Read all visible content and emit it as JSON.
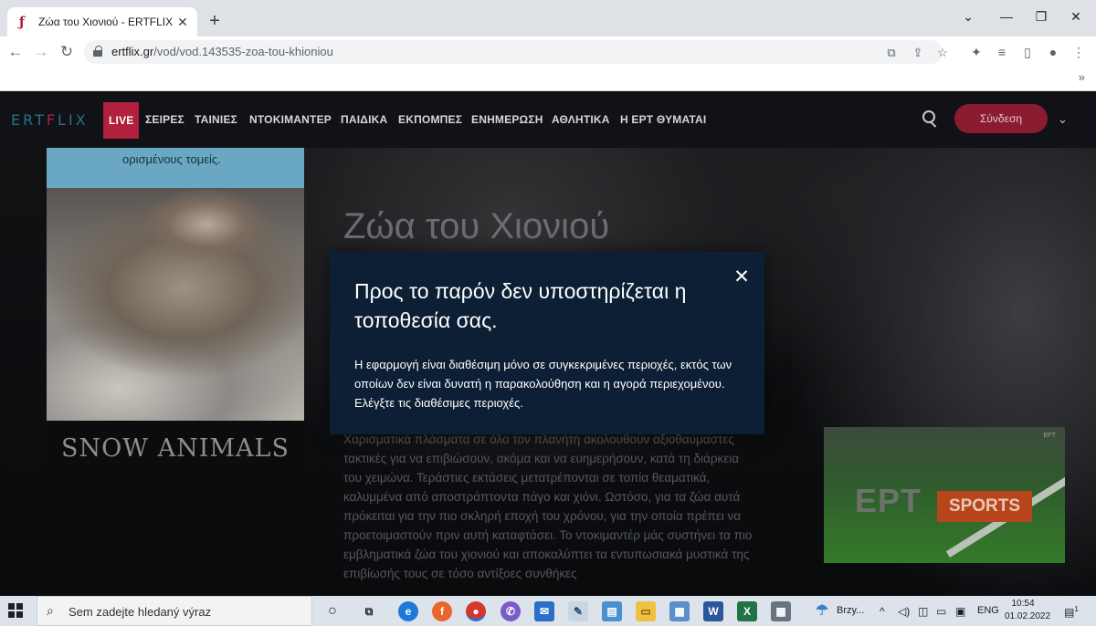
{
  "browser": {
    "tab_title": "Ζώα του Χιονιού - ERTFLIX",
    "tab_close": "✕",
    "new_tab": "+",
    "url_domain": "ertflix.gr",
    "url_path": "/vod/vod.143535-zoa-tou-khioniou",
    "bookmarks_more": "»"
  },
  "nav": {
    "logo_left": "ERT",
    "logo_mid": "F",
    "logo_right": "LIX",
    "items": [
      "LIVE",
      "ΣΕΙΡΕΣ",
      "ΤΑΙΝΙΕΣ",
      "ΝΤΟΚΙΜΑΝΤΕΡ",
      "ΠΑΙΔΙΚΑ",
      "ΕΚΠΟΜΠΕΣ",
      "ΕΝΗΜΕΡΩΣΗ",
      "ΑΘΛΗΤΙΚΑ",
      "Η ΕΡΤ ΘΥΜΑΤΑΙ"
    ],
    "login_label": "Σύνδεση",
    "menu_chevron": "⌄"
  },
  "content": {
    "poster_band_text": "ορισμένους τομείς.",
    "poster_title": "SNOW ANIMALS",
    "title": "Ζώα του Χιονιού",
    "description": "Χαρισματικά πλάσματα σε όλο τον πλανήτη ακολουθούν αξιοθαύμαστες τακτικές για να επιβιώσουν, ακόμα και να ευημερήσουν, κατά τη διάρκεια του χειμώνα. Τεράστιες εκτάσεις μετατρέπονται σε τοπία θεαματικά, καλυμμένα από αποστράπτοντα πάγο και χιόνι. Ωστόσο, για τα ζώα αυτά πρόκειται για την πιο σκληρή εποχή του χρόνου, για την οποία πρέπει να προετοιμαστούν πριν αυτή καταφτάσει. Το ντοκιμαντέρ μάς συστήνει τα πιο εμβληματικά ζώα του χιονιού και αποκαλύπτει τα εντυπωσιακά μυστικά της επιβίωσής τους σε τόσο αντίξοες συνθήκες",
    "thumb_ert": "ΕΡΤ",
    "thumb_sports": "SPORTS",
    "thumb_mini": "ΕΡΤ"
  },
  "modal": {
    "close_label": "✕",
    "title": "Προς το παρόν δεν υποστηρίζεται η τοποθεσία σας.",
    "body": "Η εφαρμογή είναι διαθέσιμη μόνο σε συγκεκριμένες περιοχές, εκτός των οποίων δεν είναι δυνατή η παρακολούθηση και η αγορά περιεχομένου. Ελέγξτε τις διαθέσιμες περιοχές."
  },
  "taskbar": {
    "search_placeholder": "Sem zadejte hledaný výraz",
    "weather_label": "Brzy...",
    "language": "ENG",
    "time": "10:54",
    "date": "01.02.2022",
    "notifications": "1"
  },
  "colors": {
    "accent": "#b1203c",
    "modal_bg": "#0c1f34",
    "nav_bg": "#101218"
  }
}
